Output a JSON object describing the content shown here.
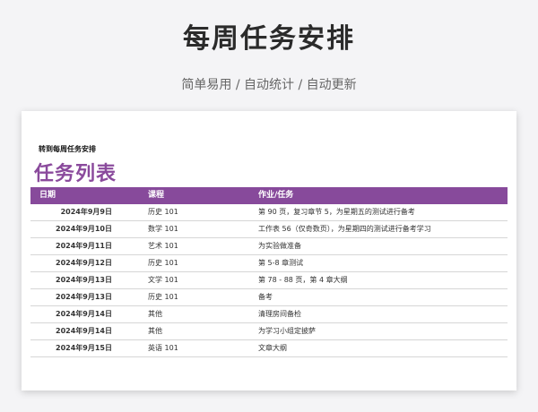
{
  "page": {
    "title": "每周任务安排",
    "subtitle": "简单易用  /  自动统计  /  自动更新"
  },
  "sheet": {
    "link_text": "转到每周任务安排",
    "title": "任务列表",
    "headers": {
      "date": "日期",
      "course": "课程",
      "task": "作业/任务"
    },
    "rows": [
      {
        "date": "2024年9月9日",
        "course": "历史 101",
        "task": "第 90 页，复习章节 5，为星期五的测试进行备考"
      },
      {
        "date": "2024年9月10日",
        "course": "数学 101",
        "task": "工作表 56（仅奇数页），为星期四的测试进行备考学习"
      },
      {
        "date": "2024年9月11日",
        "course": "艺术 101",
        "task": "为实验做准备"
      },
      {
        "date": "2024年9月12日",
        "course": "历史 101",
        "task": "第 5-8 章测试"
      },
      {
        "date": "2024年9月13日",
        "course": "文学 101",
        "task": "第 78 - 88 页，第 4 章大纲"
      },
      {
        "date": "2024年9月13日",
        "course": "历史 101",
        "task": "备考"
      },
      {
        "date": "2024年9月14日",
        "course": "其他",
        "task": "清理房间备检"
      },
      {
        "date": "2024年9月14日",
        "course": "其他",
        "task": "为学习小组定披萨"
      },
      {
        "date": "2024年9月15日",
        "course": "英语 101",
        "task": "文章大纲"
      }
    ]
  },
  "colors": {
    "accent": "#874a9b",
    "title_purple": "#8a4a9c"
  }
}
